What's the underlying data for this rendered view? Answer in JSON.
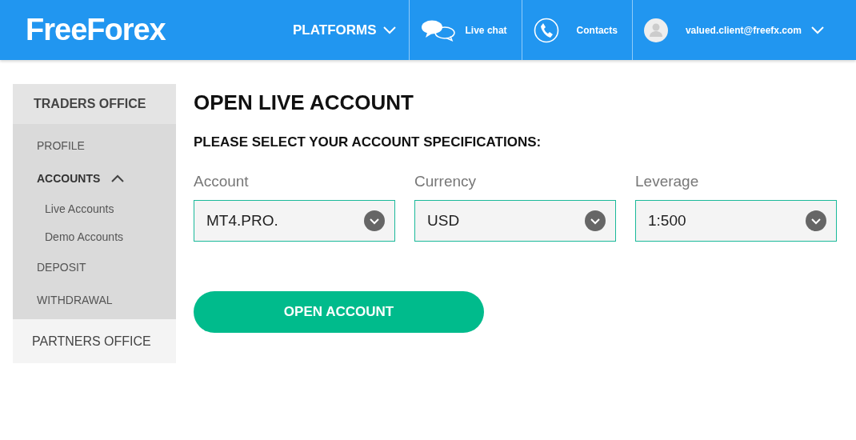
{
  "header": {
    "logo": "FreeForex",
    "nav": [
      {
        "kind": "menu",
        "label": "PLATFORMS"
      },
      {
        "kind": "chat",
        "label": "Live chat"
      },
      {
        "kind": "phone",
        "label": "Contacts"
      },
      {
        "kind": "user",
        "label": "valued.client@freefx.com"
      }
    ]
  },
  "sidebar": {
    "sections": [
      {
        "label": "TRADERS OFFICE",
        "expanded": true,
        "items": [
          {
            "label": "PROFILE",
            "selected": false
          },
          {
            "label": "ACCOUNTS",
            "selected": true,
            "expanded": true,
            "children": [
              {
                "label": "Live Accounts"
              },
              {
                "label": "Demo Accounts"
              }
            ]
          },
          {
            "label": "DEPOSIT",
            "selected": false
          },
          {
            "label": "WITHDRAWAL",
            "selected": false
          }
        ]
      },
      {
        "label": "PARTNERS OFFICE",
        "expanded": false
      }
    ]
  },
  "main": {
    "title": "OPEN LIVE ACCOUNT",
    "subtitle": "PLEASE SELECT YOUR ACCOUNT SPECIFICATIONS:",
    "fields": [
      {
        "label": "Account",
        "value": "MT4.PRO."
      },
      {
        "label": "Currency",
        "value": "USD"
      },
      {
        "label": "Leverage",
        "value": "1:500"
      }
    ],
    "button": "OPEN ACCOUNT"
  }
}
